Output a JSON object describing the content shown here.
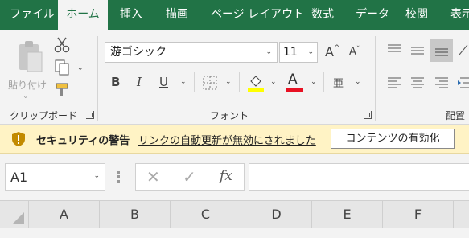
{
  "tabs": [
    {
      "label": "ファイル"
    },
    {
      "label": "ホーム"
    },
    {
      "label": "挿入"
    },
    {
      "label": "描画"
    },
    {
      "label": "ページ レイアウト"
    },
    {
      "label": "数式"
    },
    {
      "label": "データ"
    },
    {
      "label": "校閲"
    },
    {
      "label": "表示"
    }
  ],
  "clipboard": {
    "paste_label": "貼り付け",
    "group_label": "クリップボード"
  },
  "font": {
    "name": "游ゴシック",
    "size": "11",
    "group_label": "フォント",
    "bold": "B",
    "italic": "I",
    "underline": "U",
    "font_color_letter": "A",
    "grow": "A",
    "shrink": "A",
    "highlight_color": "#ffff00",
    "font_color": "#e81123"
  },
  "alignment": {
    "group_label": "配置"
  },
  "security": {
    "title": "セキュリティの警告",
    "message": "リンクの自動更新が無効にされました",
    "button": "コンテンツの有効化"
  },
  "formula": {
    "name_box": "A1",
    "fx": "fx"
  },
  "columns": [
    "A",
    "B",
    "C",
    "D",
    "E",
    "F"
  ],
  "colors": {
    "accent": "#217346",
    "warning_bg": "#fff3c5"
  }
}
